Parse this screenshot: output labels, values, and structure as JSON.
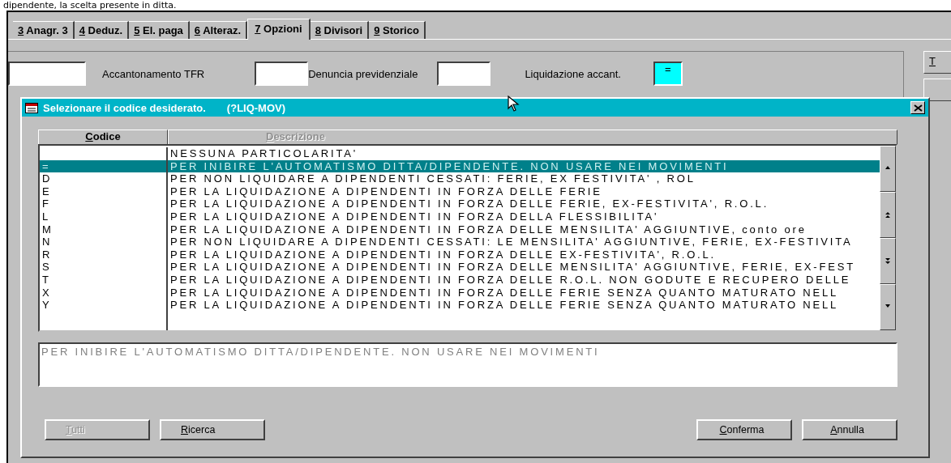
{
  "caption": "dipendente, la scelta presente in ditta.",
  "tabs": [
    {
      "key": "3",
      "label": " Anagr. 3",
      "selected": false
    },
    {
      "key": "4",
      "label": " Deduz.",
      "selected": false
    },
    {
      "key": "5",
      "label": " El. paga",
      "selected": false
    },
    {
      "key": "6",
      "label": " Alteraz.",
      "selected": false
    },
    {
      "key": "7",
      "label": " Opzioni",
      "selected": true
    },
    {
      "key": "8",
      "label": " Divisori",
      "selected": false
    },
    {
      "key": "9",
      "label": " Storico",
      "selected": false
    }
  ],
  "fields": [
    {
      "label": "Accantonamento TFR",
      "highlighted": false
    },
    {
      "label": "Denuncia previdenziale",
      "highlighted": false
    },
    {
      "label": "Liquidazione accant.",
      "value": "=",
      "highlighted": true
    }
  ],
  "side_buttons": [
    {
      "key": "T"
    }
  ],
  "dialog": {
    "title": "Selezionare il codice desiderato.",
    "code": "(?LIQ-MOV)",
    "columns": [
      {
        "key": "C",
        "label": "odice",
        "disabled": false
      },
      {
        "key": "D",
        "label": "escrizione",
        "disabled": true
      }
    ],
    "rows": [
      {
        "code": "",
        "description": "NESSUNA PARTICOLARITA'",
        "selected": false
      },
      {
        "code": "=",
        "description": "PER INIBIRE L'AUTOMATISMO DITTA/DIPENDENTE. NON USARE NEI MOVIMENTI",
        "selected": true
      },
      {
        "code": "D",
        "description": "PER NON LIQUIDARE A DIPENDENTI CESSATI: FERIE, EX FESTIVITA' , ROL",
        "selected": false
      },
      {
        "code": "E",
        "description": "PER LA LIQUIDAZIONE A DIPENDENTI IN FORZA DELLE FERIE",
        "selected": false
      },
      {
        "code": "F",
        "description": "PER LA LIQUIDAZIONE A DIPENDENTI IN FORZA DELLE FERIE, EX-FESTIVITA', R.O.L.",
        "selected": false
      },
      {
        "code": "L",
        "description": "PER LA LIQUIDAZIONE A DIPENDENTI IN FORZA DELLA FLESSIBILITA'",
        "selected": false
      },
      {
        "code": "M",
        "description": "PER LA LIQUIDAZIONE A DIPENDENTI IN FORZA DELLE MENSILITA' AGGIUNTIVE, conto ore",
        "selected": false
      },
      {
        "code": "N",
        "description": "PER NON LIQUIDARE A DIPENDENTI CESSATI: LE MENSILITA' AGGIUNTIVE, FERIE, EX-FESTIVITA",
        "selected": false
      },
      {
        "code": "R",
        "description": "PER LA LIQUIDAZIONE A DIPENDENTI IN FORZA DELLE  EX-FESTIVITA', R.O.L.",
        "selected": false
      },
      {
        "code": "S",
        "description": "PER LA LIQUIDAZIONE A DIPENDENTI IN FORZA DELLE MENSILITA' AGGIUNTIVE, FERIE, EX-FEST",
        "selected": false
      },
      {
        "code": "T",
        "description": "PER LA LIQUIDAZIONE A DIPENDENTI IN FORZA DELLE R.O.L. NON GODUTE E RECUPERO DELLE",
        "selected": false
      },
      {
        "code": "X",
        "description": "PER LA LIQUIDAZIONE A DIPENDENTI IN FORZA DELLE FERIE SENZA QUANTO MATURATO NELL",
        "selected": false
      },
      {
        "code": "Y",
        "description": "PER LA LIQUIDAZIONE A DIPENDENTI IN FORZA DELLE FERIE SENZA QUANTO MATURATO NELL",
        "selected": false
      }
    ],
    "detail": "PER INIBIRE L'AUTOMATISMO DITTA/DIPENDENTE. NON USARE NEI MOVIMENTI",
    "buttons_left": [
      {
        "key": "T",
        "label": "utti",
        "disabled": true
      },
      {
        "key": "R",
        "label": "icerca",
        "disabled": false
      }
    ],
    "buttons_right": [
      {
        "key": "C",
        "label": "onferma",
        "disabled": false
      },
      {
        "key": "A",
        "label": "nnulla",
        "disabled": false
      }
    ]
  }
}
